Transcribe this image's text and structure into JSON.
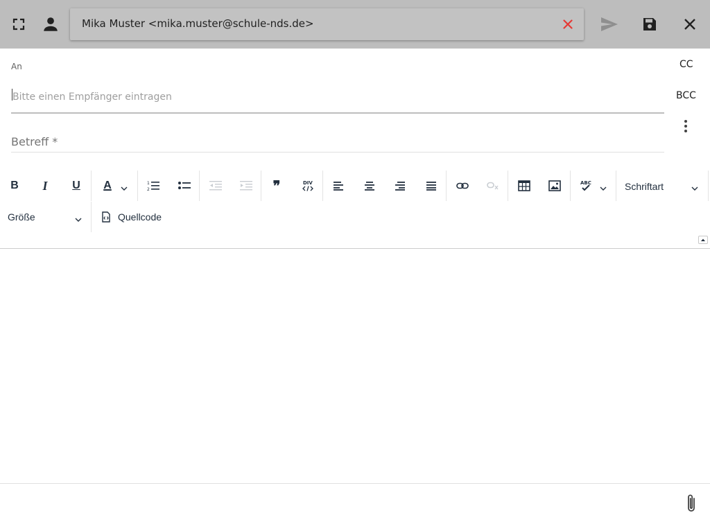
{
  "header": {
    "from_value": "Mika Muster <mika.muster@schule-nds.de>",
    "icons": [
      "fullscreen-icon",
      "person-icon",
      "clear-icon",
      "send-icon",
      "save-icon",
      "close-icon"
    ],
    "clear_color": "#e53935"
  },
  "recipients": {
    "to_label": "An",
    "to_placeholder": "Bitte einen Empfänger eintragen",
    "cc_label": "CC",
    "bcc_label": "BCC"
  },
  "subject": {
    "placeholder": "Betreff *"
  },
  "toolbar": {
    "font_family_label": "Schriftart",
    "font_size_label": "Größe",
    "source_code_label": "Quellcode",
    "bold_glyph": "B",
    "italic_glyph": "I",
    "underline_glyph": "U",
    "text_color_glyph": "A",
    "blockquote_glyph": "❞"
  },
  "footer": {
    "icons": [
      "paperclip-icon"
    ]
  }
}
